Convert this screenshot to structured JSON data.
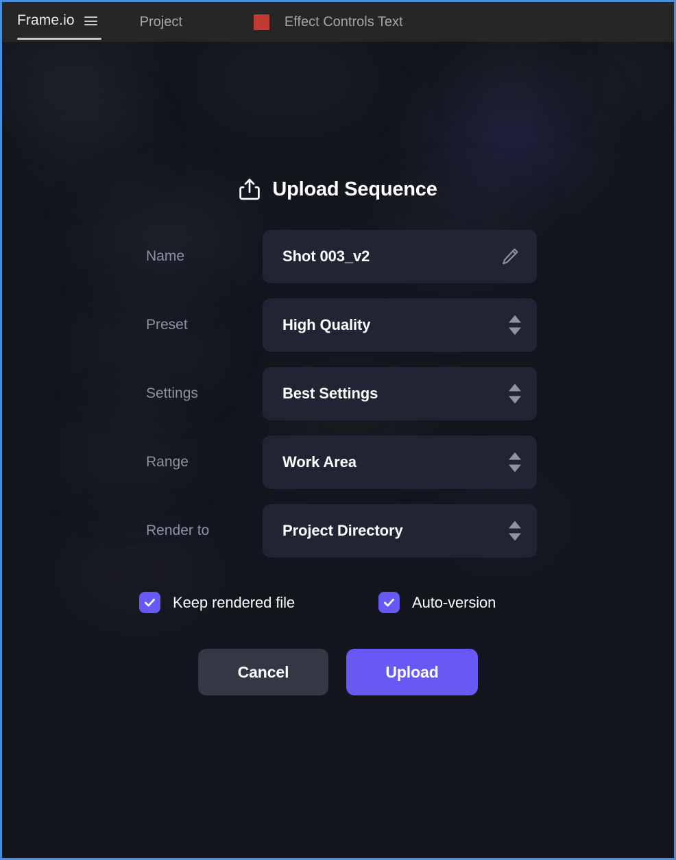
{
  "window": {
    "border_color": "#4a8ddc",
    "background": "#15171f"
  },
  "topbar": {
    "background": "#262626",
    "tabs": [
      {
        "label": "Frame.io",
        "active": true,
        "icon": "hamburger-icon"
      },
      {
        "label": "Project",
        "active": false
      },
      {
        "label": "Effect Controls Text",
        "active": false,
        "chip_color": "#bf3b33"
      }
    ]
  },
  "dialog": {
    "title": "Upload Sequence",
    "title_icon": "upload-share-icon",
    "fields": [
      {
        "label": "Name",
        "value": "Shot 003_v2",
        "control": "text",
        "icon": "pencil-icon",
        "name": "name"
      },
      {
        "label": "Preset",
        "value": "High Quality",
        "control": "stepper",
        "icon": "stepper-arrows-icon",
        "name": "preset"
      },
      {
        "label": "Settings",
        "value": "Best Settings",
        "control": "stepper",
        "icon": "stepper-arrows-icon",
        "name": "settings"
      },
      {
        "label": "Range",
        "value": "Work Area",
        "control": "stepper",
        "icon": "stepper-arrows-icon",
        "name": "range"
      },
      {
        "label": "Render to",
        "value": "Project Directory",
        "control": "stepper",
        "icon": "stepper-arrows-icon",
        "name": "render-to"
      }
    ],
    "checkboxes": [
      {
        "label": "Keep rendered file",
        "checked": true,
        "name": "keep-rendered-file"
      },
      {
        "label": "Auto-version",
        "checked": true,
        "name": "auto-version"
      }
    ],
    "buttons": {
      "cancel": "Cancel",
      "upload": "Upload"
    }
  },
  "colors": {
    "accent": "#6659f5",
    "field_bg": "#212533",
    "label_text": "#8d93a6",
    "cancel_bg": "#343845",
    "stepper_arrow": "#8d93a3",
    "chip_red": "#bf3b33"
  }
}
